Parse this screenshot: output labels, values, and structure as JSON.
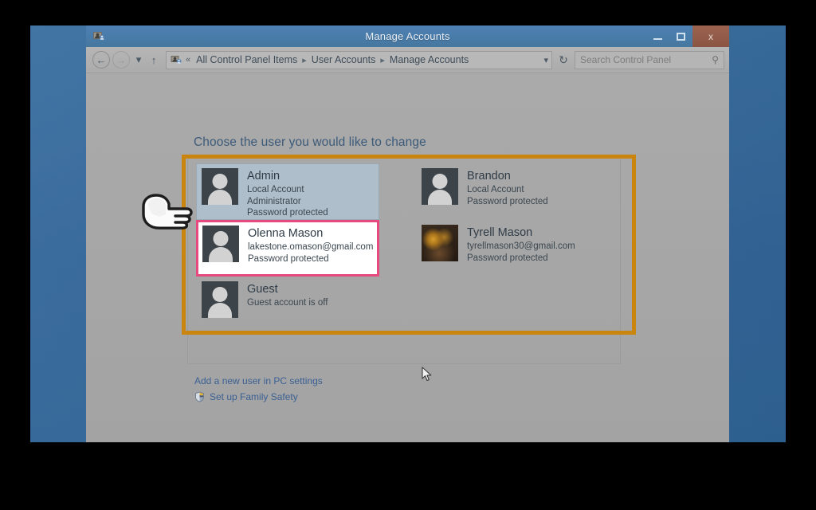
{
  "window": {
    "title": "Manage Accounts",
    "title_icon": "user-accounts-icon",
    "minimize_label": "Minimize",
    "maximize_label": "Maximize",
    "close_label": "x"
  },
  "addressbar": {
    "back_icon": "back-arrow-icon",
    "forward_icon": "forward-arrow-icon",
    "recent_icon": "chevron-down-icon",
    "up_icon": "up-arrow-icon",
    "path_icon": "control-panel-icon",
    "overflow": "«",
    "crumbs": [
      {
        "label": "All Control Panel Items"
      },
      {
        "label": "User Accounts"
      },
      {
        "label": "Manage Accounts"
      }
    ],
    "separator": "▸",
    "dropdown_icon": "chevron-down-icon",
    "refresh_icon": "refresh-icon",
    "search_placeholder": "Search Control Panel",
    "search_value": "",
    "search_icon": "magnifier-icon"
  },
  "main": {
    "heading": "Choose the user you would like to change",
    "accounts": [
      {
        "name": "Admin",
        "lines": [
          "Local Account",
          "Administrator",
          "Password protected"
        ],
        "avatar": "default-user-avatar",
        "state": "selected"
      },
      {
        "name": "Brandon",
        "lines": [
          "Local Account",
          "Password protected"
        ],
        "avatar": "default-user-avatar",
        "state": "normal"
      },
      {
        "name": "Olenna Mason",
        "lines": [
          "lakestone.omason@gmail.com",
          "Password protected"
        ],
        "avatar": "default-user-avatar",
        "state": "highlighted"
      },
      {
        "name": "Tyrell Mason",
        "lines": [
          "tyrellmason30@gmail.com",
          "Password protected"
        ],
        "avatar": "photo-avatar",
        "state": "normal"
      },
      {
        "name": "Guest",
        "lines": [
          "Guest account is off"
        ],
        "avatar": "default-user-avatar",
        "state": "normal"
      }
    ],
    "links": [
      {
        "label": "Add a new user in PC settings",
        "icon": ""
      },
      {
        "label": "Set up Family Safety",
        "icon": "shield-icon"
      }
    ]
  },
  "annotations": {
    "highlight_box_color": "#c9850e",
    "selection_box_color": "#e64a7f",
    "hand_cursor": "pointing-hand-cursor",
    "arrow_cursor": "arrow-cursor"
  }
}
